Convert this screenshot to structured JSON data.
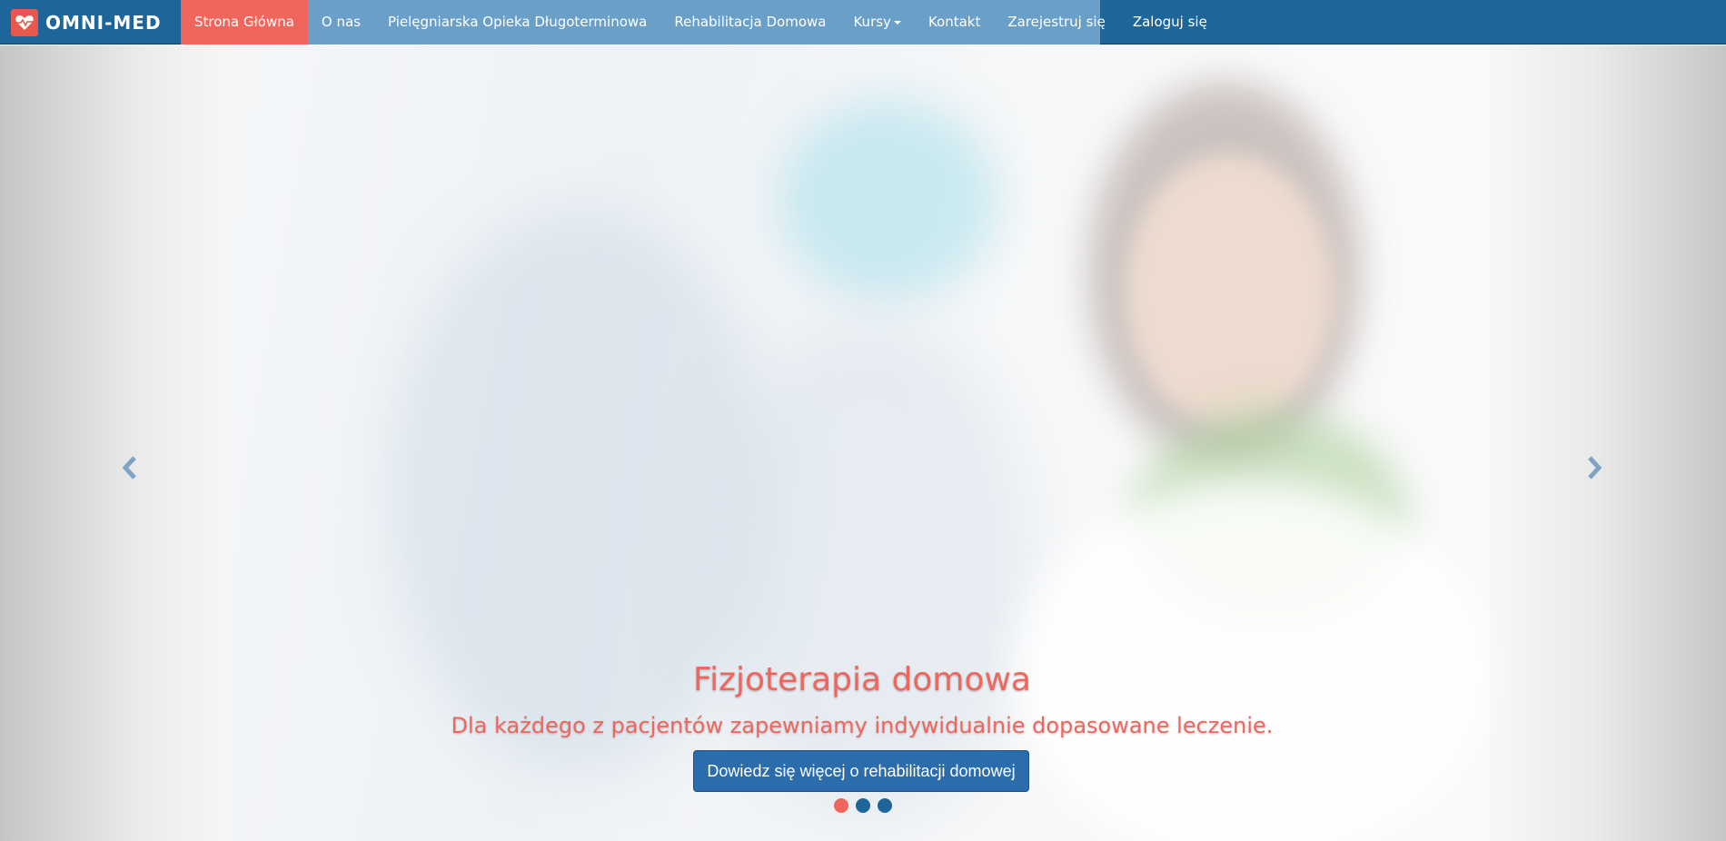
{
  "brand": {
    "name": "OMNI-MED"
  },
  "nav": {
    "items": [
      {
        "label": "Strona Główna",
        "active": true
      },
      {
        "label": "O nas"
      },
      {
        "label": "Pielęgniarska Opieka Długoterminowa"
      },
      {
        "label": "Rehabilitacja Domowa"
      },
      {
        "label": "Kursy",
        "dropdown": true
      },
      {
        "label": "Kontakt"
      },
      {
        "label": "Zarejestruj się"
      },
      {
        "label": "Zaloguj się"
      }
    ]
  },
  "slide": {
    "title": "Fizjoterapia domowa",
    "subtitle": "Dla każdego z pacjentów zapewniamy indywidualnie dopasowane leczenie.",
    "cta_label": "Dowiedz się więcej o rehabilitacji domowej"
  },
  "carousel": {
    "indicator_count": 3,
    "active_index": 0,
    "prev_icon": "chevron-left-icon",
    "next_icon": "chevron-right-icon"
  },
  "colors": {
    "navbar": "#1e6699",
    "nav_strip": "#6a9fc8",
    "accent": "#f0665c",
    "button": "#2b6cad"
  }
}
